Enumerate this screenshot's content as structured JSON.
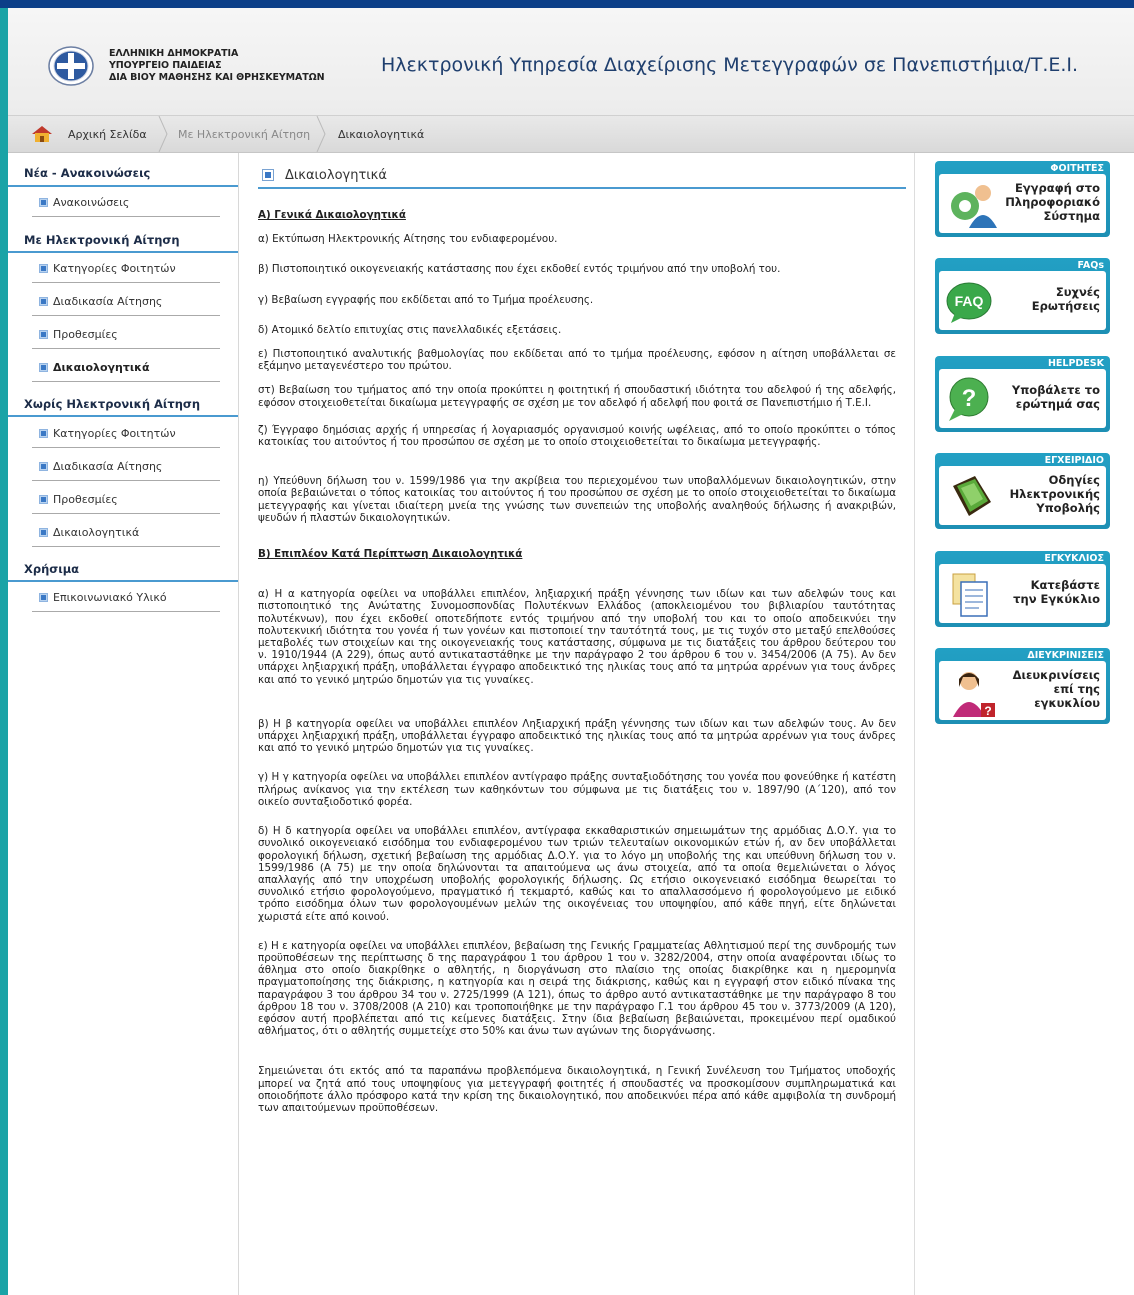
{
  "header": {
    "ministry_lines": [
      "ΕΛΛΗΝΙΚΗ ΔΗΜΟΚΡΑΤΙΑ",
      "ΥΠΟΥΡΓΕΙΟ ΠΑΙΔΕΙΑΣ",
      "ΔΙΑ ΒΙΟΥ ΜΑΘΗΣΗΣ ΚΑΙ ΘΡΗΣΚΕΥΜΑΤΩΝ"
    ],
    "title": "Ηλεκτρονική Υπηρεσία Διαχείρισης Μετεγγραφών σε Πανεπιστήμια/Τ.Ε.Ι."
  },
  "breadcrumb": {
    "home": "Αρχική Σελίδα",
    "section": "Με Ηλεκτρονική Αίτηση",
    "current": "Δικαιολογητικά"
  },
  "sidebar": {
    "news_heading": "Νέα - Ανακοινώσεις",
    "news_item": "Ανακοινώσεις",
    "electronic_heading": "Με Ηλεκτρονική Αίτηση",
    "electronic_items": [
      "Κατηγορίες Φοιτητών",
      "Διαδικασία Αίτησης",
      "Προθεσμίες",
      "Δικαιολογητικά"
    ],
    "non_electronic_heading": "Χωρίς Ηλεκτρονική Αίτηση",
    "non_electronic_items": [
      "Κατηγορίες Φοιτητών",
      "Διαδικασία Αίτησης",
      "Προθεσμίες",
      "Δικαιολογητικά"
    ],
    "useful_heading": "Χρήσιμα",
    "useful_item": "Επικοινωνιακό Υλικό"
  },
  "content": {
    "title": "Δικαιολογητικά",
    "section_a_title": "Α) Γενικά Δικαιολογητικά",
    "section_a": [
      "α) Εκτύπωση Ηλεκτρονικής Αίτησης του ενδιαφερομένου.",
      "β) Πιστοποιητικό οικογενειακής κατάστασης που έχει εκδοθεί εντός τριμήνου από την υποβολή του.",
      "γ) Βεβαίωση εγγραφής που εκδίδεται από το Τμήμα προέλευσης.",
      "δ) Ατομικό δελτίο επιτυχίας στις πανελλαδικές εξετάσεις.",
      "ε) Πιστοποιητικό αναλυτικής βαθμολογίας που εκδίδεται από το τμήμα προέλευσης, εφόσον η αίτηση υποβάλλεται σε εξάμηνο μεταγενέστερο του πρώτου.",
      "στ) Βεβαίωση του τμήματος από την οποία προκύπτει η φοιτητική ή σπουδαστική ιδιότητα του αδελφού ή της αδελφής, εφόσον στοιχειοθετείται δικαίωμα μετεγγραφής σε σχέση με τον αδελφό ή αδελφή που φοιτά σε Πανεπιστήμιο ή Τ.Ε.Ι.",
      "ζ) Έγγραφο δημόσιας αρχής ή υπηρεσίας ή λογαριασμός οργανισμού κοινής ωφέλειας, από το οποίο προκύπτει ο τόπος κατοικίας του αιτούντος ή του προσώπου σε σχέση με το οποίο στοιχειοθετείται το δικαίωμα μετεγγραφής.",
      "η) Υπεύθυνη δήλωση του ν. 1599/1986 για την ακρίβεια του περιεχομένου των υποβαλλόμενων δικαιολογητικών, στην οποία βεβαιώνεται ο τόπος κατοικίας του αιτούντος ή του προσώπου σε σχέση με το οποίο στοιχειοθετείται το δικαίωμα μετεγγραφής και γίνεται ιδιαίτερη μνεία της γνώσης των συνεπειών της υποβολής αναληθούς δήλωσης ή ανακριβών, ψευδών ή πλαστών δικαιολογητικών."
    ],
    "section_b_title": "Β) Επιπλέον Κατά Περίπτωση Δικαιολογητικά",
    "section_b": [
      "α) Η α κατηγορία οφείλει να υποβάλλει επιπλέον, ληξιαρχική πράξη γέννησης των ιδίων και των αδελφών τους και πιστοποιητικό της Ανώτατης Συνομοσπονδίας Πολυτέκνων Ελλάδος (αποκλειομένου του βιβλιαρίου ταυτότητας πολυτέκνων), που έχει εκδοθεί οποτεδήποτε εντός τριμήνου από την υποβολή του και το οποίο αποδεικνύει την πολυτεκνική ιδιότητα του γονέα ή των γονέων και πιστοποιεί την ταυτότητά τους, με τις τυχόν στο μεταξύ επελθούσες μεταβολές των στοιχείων και της οικογενειακής τους κατάστασης, σύμφωνα με τις διατάξεις του άρθρου δεύτερου του ν. 1910/1944 (Α 229), όπως αυτό αντικαταστάθηκε με την παράγραφο 2 του άρθρου 6 του ν. 3454/2006 (Α 75). Αν δεν υπάρχει ληξιαρχική πράξη, υποβάλλεται έγγραφο αποδεικτικό της ηλικίας τους από τα μητρώα αρρένων για τους άνδρες και από το γενικό μητρώο δημοτών για τις γυναίκες.",
      "β) Η β κατηγορία οφείλει να υποβάλλει επιπλέον Ληξιαρχική πράξη γέννησης των ιδίων και των αδελφών τους. Αν δεν υπάρχει ληξιαρχική πράξη, υποβάλλεται έγγραφο αποδεικτικό της ηλικίας τους από τα μητρώα αρρένων για τους άνδρες και από το γενικό μητρώο δημοτών για τις γυναίκες.",
      "γ) Η γ κατηγορία οφείλει να υποβάλλει επιπλέον αντίγραφο πράξης συνταξιοδότησης του γονέα που φονεύθηκε ή κατέστη πλήρως ανίκανος για την εκτέλεση των καθηκόντων του σύμφωνα με τις διατάξεις του ν. 1897/90 (Α΄120), από τον οικείο συνταξιοδοτικό φορέα.",
      "δ) Η δ κατηγορία οφείλει να υποβάλλει επιπλέον, αντίγραφα εκκαθαριστικών σημειωμάτων της αρμόδιας Δ.Ο.Υ. για το συνολικό οικογενειακό εισόδημα του ενδιαφερομένου των τριών τελευταίων οικονομικών ετών ή, αν δεν υποβάλλεται φορολογική δήλωση, σχετική βεβαίωση της αρμόδιας Δ.Ο.Υ. για το λόγο μη υποβολής της και υπεύθυνη δήλωση του ν. 1599/1986 (Α 75) με την οποία δηλώνονται τα απαιτούμενα ως άνω στοιχεία, από τα οποία θεμελιώνεται ο λόγος απαλλαγής από την υποχρέωση υποβολής φορολογικής δήλωσης. Ως ετήσιο οικογενειακό εισόδημα θεωρείται το συνολικό ετήσιο φορολογούμενο, πραγματικό ή τεκμαρτό, καθώς και το απαλλασσόμενο ή φορολογούμενο με ειδικό τρόπο εισόδημα όλων των φορολογουμένων μελών της οικογένειας του υποψηφίου, από κάθε πηγή, είτε δηλώνεται χωριστά είτε από κοινού.",
      "ε) Η ε κατηγορία οφείλει να υποβάλλει επιπλέον, βεβαίωση της Γενικής Γραμματείας Αθλητισμού περί της συνδρομής των προϋποθέσεων της περίπτωσης δ της παραγράφου 1 του άρθρου 1 του ν. 3282/2004, στην οποία αναφέρονται ιδίως το άθλημα στο οποίο διακρίθηκε ο αθλητής, η διοργάνωση στο πλαίσιο της οποίας διακρίθηκε και η ημερομηνία πραγματοποίησης της διάκρισης, η κατηγορία και η σειρά της διάκρισης, καθώς και η εγγραφή στον ειδικό πίνακα της παραγράφου 3 του άρθρου 34 του ν. 2725/1999 (Α 121), όπως το άρθρο αυτό αντικαταστάθηκε με την παράγραφο 8 του άρθρου 18 του ν. 3708/2008 (Α 210) και τροποποιήθηκε με την παράγραφο Γ.1 του άρθρου 45 του ν. 3773/2009 (Α 120), εφόσον αυτή προβλέπεται από τις κείμενες διατάξεις. Στην ίδια βεβαίωση βεβαιώνεται, προκειμένου περί ομαδικού αθλήματος, ότι ο αθλητής συμμετείχε στο 50% και άνω των αγώνων της διοργάνωσης."
    ],
    "closing": "Σημειώνεται ότι εκτός από τα παραπάνω προβλεπόμενα δικαιολογητικά, η Γενική Συνέλευση του Τμήματος υποδοχής μπορεί να ζητά από τους υποψηφίους για μετεγγραφή φοιτητές ή σπουδαστές να προσκομίσουν συμπληρωματικά και οποιοδήποτε άλλο πρόσφορο κατά την κρίση της δικαιολογητικό, που αποδεικνύει πέρα από κάθε αμφιβολία τη συνδρομή των απαιτούμενων προϋποθέσεων."
  },
  "right_panel": [
    {
      "header": "ΦΟΙΤΗΤΕΣ",
      "lines": [
        "Εγγραφή στο",
        "Πληροφοριακό",
        "Σύστημα"
      ],
      "icon": "students-icon"
    },
    {
      "header": "FAQs",
      "lines": [
        "Συχνές",
        "Ερωτήσεις"
      ],
      "icon": "faq-icon"
    },
    {
      "header": "HELPDESK",
      "lines": [
        "Υποβάλετε το",
        "ερώτημά σας"
      ],
      "icon": "help-icon"
    },
    {
      "header": "ΕΓΧΕΙΡΙΔΙΟ",
      "lines": [
        "Οδηγίες",
        "Ηλεκτρονικής",
        "Υποβολής"
      ],
      "icon": "book-icon"
    },
    {
      "header": "ΕΓΚΥΚΛΙΟΣ",
      "lines": [
        "Κατεβάστε",
        "την Εγκύκλιο"
      ],
      "icon": "document-icon"
    },
    {
      "header": "ΔΙΕΥΚΡΙΝΙΣΕΙΣ",
      "lines": [
        "Διευκρινίσεις",
        "επί της",
        "εγκυκλίου"
      ],
      "icon": "user-question-icon"
    }
  ],
  "faq_icon_text": "FAQ",
  "colors": {
    "accent": "#4a9ad0",
    "frame": "#1aa3a6",
    "topbar": "#0c3f88",
    "panel": "#1d8fb4"
  }
}
